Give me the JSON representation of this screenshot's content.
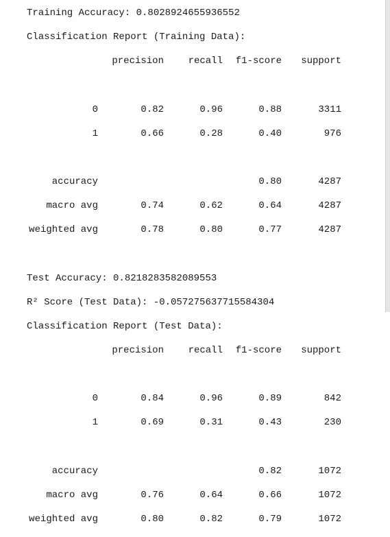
{
  "train": {
    "accuracy_line": "Training Accuracy: 0.8028924655936552",
    "report_title": "Classification Report (Training Data):",
    "headers": [
      "precision",
      "recall",
      "f1-score",
      "support"
    ],
    "rows": [
      {
        "label": "0",
        "precision": "0.82",
        "recall": "0.96",
        "f1": "0.88",
        "support": "3311"
      },
      {
        "label": "1",
        "precision": "0.66",
        "recall": "0.28",
        "f1": "0.40",
        "support": "976"
      }
    ],
    "accuracy": {
      "label": "accuracy",
      "f1": "0.80",
      "support": "4287"
    },
    "macro": {
      "label": "macro avg",
      "precision": "0.74",
      "recall": "0.62",
      "f1": "0.64",
      "support": "4287"
    },
    "weighted": {
      "label": "weighted avg",
      "precision": "0.78",
      "recall": "0.80",
      "f1": "0.77",
      "support": "4287"
    }
  },
  "test": {
    "accuracy_line": "Test Accuracy: 0.8218283582089553",
    "r2_line": "R² Score (Test Data): -0.057275637715584304",
    "report_title": "Classification Report (Test Data):",
    "headers": [
      "precision",
      "recall",
      "f1-score",
      "support"
    ],
    "rows": [
      {
        "label": "0",
        "precision": "0.84",
        "recall": "0.96",
        "f1": "0.89",
        "support": "842"
      },
      {
        "label": "1",
        "precision": "0.69",
        "recall": "0.31",
        "f1": "0.43",
        "support": "230"
      }
    ],
    "accuracy": {
      "label": "accuracy",
      "f1": "0.82",
      "support": "1072"
    },
    "macro": {
      "label": "macro avg",
      "precision": "0.76",
      "recall": "0.64",
      "f1": "0.66",
      "support": "1072"
    },
    "weighted": {
      "label": "weighted avg",
      "precision": "0.80",
      "recall": "0.82",
      "f1": "0.79",
      "support": "1072"
    }
  }
}
